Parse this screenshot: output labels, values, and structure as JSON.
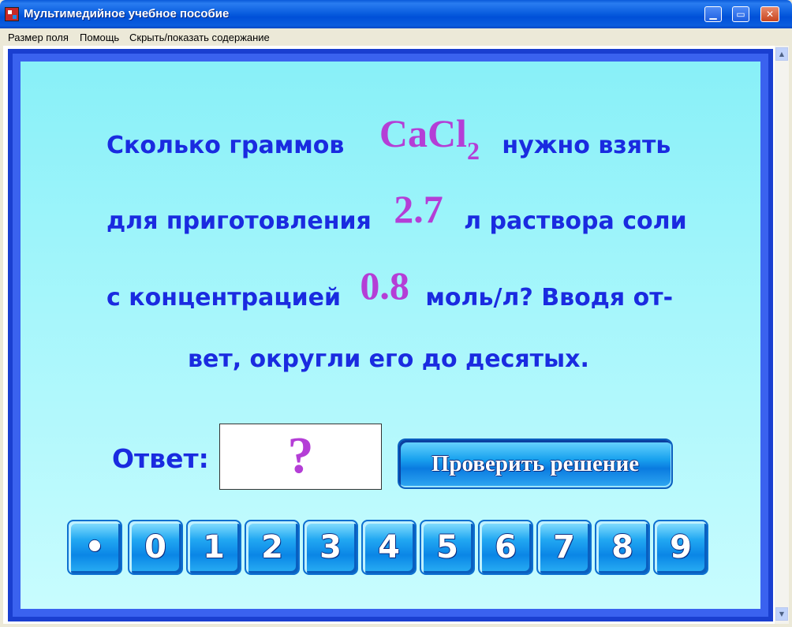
{
  "window": {
    "title": "Мультимедийное учебное пособие",
    "minimize_glyph": "▁",
    "maximize_glyph": "▭",
    "close_glyph": "✕"
  },
  "menu": {
    "items": [
      "Размер поля",
      "Помощь",
      "Скрыть/показать содержание"
    ]
  },
  "scrollbar": {
    "up_glyph": "▲",
    "down_glyph": "▼"
  },
  "question": {
    "line1": {
      "before": "Сколько   граммов",
      "formula_main": "CaCl",
      "formula_sub": "2",
      "after": "нужно   взять"
    },
    "line2": {
      "before": "для  приготовления",
      "volume": "2.7",
      "after": "л  раствора  соли"
    },
    "line3": {
      "before": "с концентрацией",
      "concentration": "0.8",
      "after": "моль/л? Вводя от-"
    },
    "line4": {
      "text": "вет, округли его до десятых."
    }
  },
  "answer": {
    "label": "Ответ:",
    "value": "?"
  },
  "check_button": {
    "label": "Проверить решение"
  },
  "keypad": {
    "keys": [
      "•",
      "0",
      "1",
      "2",
      "3",
      "4",
      "5",
      "6",
      "7",
      "8",
      "9"
    ]
  },
  "colors": {
    "question_text": "#1a2be0",
    "highlight": "#b43ed6",
    "panel_bg": "#a6f6fb",
    "frame": "#1a3fd0"
  }
}
